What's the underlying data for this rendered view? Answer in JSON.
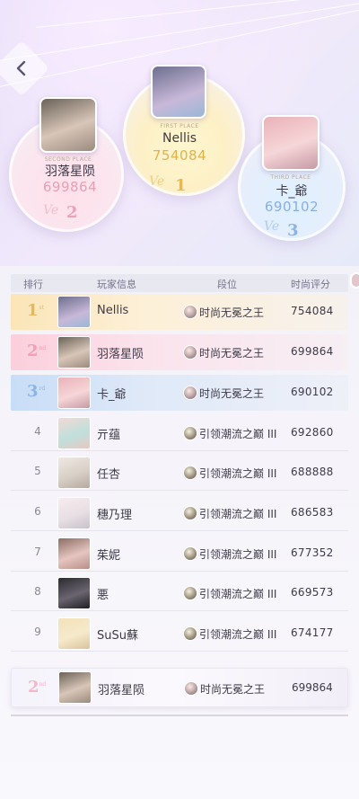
{
  "podium": {
    "first": {
      "label": "FIRST PLACE",
      "name": "Nellis",
      "score": "754084",
      "script": "Ve",
      "rank": "1"
    },
    "second": {
      "label": "SECOND PLACE",
      "name": "羽落星陨",
      "score": "699864",
      "script": "Ve",
      "rank": "2"
    },
    "third": {
      "label": "THIRD PLACE",
      "name": "卡_爺",
      "score": "690102",
      "script": "Ve",
      "rank": "3"
    }
  },
  "table": {
    "headers": {
      "rank": "排行",
      "player": "玩家信息",
      "tier": "段位",
      "score": "时尚评分"
    },
    "rows": [
      {
        "rank": "1",
        "suffix": "st",
        "name": "Nellis",
        "tier": "时尚无冕之王",
        "score": "754084"
      },
      {
        "rank": "2",
        "suffix": "nd",
        "name": "羽落星陨",
        "tier": "时尚无冕之王",
        "score": "699864"
      },
      {
        "rank": "3",
        "suffix": "rd",
        "name": "卡_爺",
        "tier": "时尚无冕之王",
        "score": "690102"
      },
      {
        "rank": "4",
        "name": "亓蕴",
        "tier": "引领潮流之巅 III",
        "score": "692860"
      },
      {
        "rank": "5",
        "name": "任杏",
        "tier": "引领潮流之巅 III",
        "score": "688888"
      },
      {
        "rank": "6",
        "name": "穗乃理",
        "tier": "引领潮流之巅 III",
        "score": "686583"
      },
      {
        "rank": "7",
        "name": "茱妮",
        "tier": "引领潮流之巅 III",
        "score": "677352"
      },
      {
        "rank": "8",
        "name": "悪",
        "tier": "引领潮流之巅 III",
        "score": "669573"
      },
      {
        "rank": "9",
        "name": "SuSu蘇",
        "tier": "引领潮流之巅 III",
        "score": "674177"
      }
    ]
  },
  "self_row": {
    "rank": "2",
    "suffix": "nd",
    "name": "羽落星陨",
    "tier": "时尚无冕之王",
    "score": "699864"
  },
  "colors": {
    "gold": "#e9b65a",
    "pink": "#f0a0b8",
    "blue": "#8cb3e6",
    "score_pink": "#e7a0b4",
    "score_gold": "#e1b24a",
    "score_blue": "#8aaee0"
  }
}
